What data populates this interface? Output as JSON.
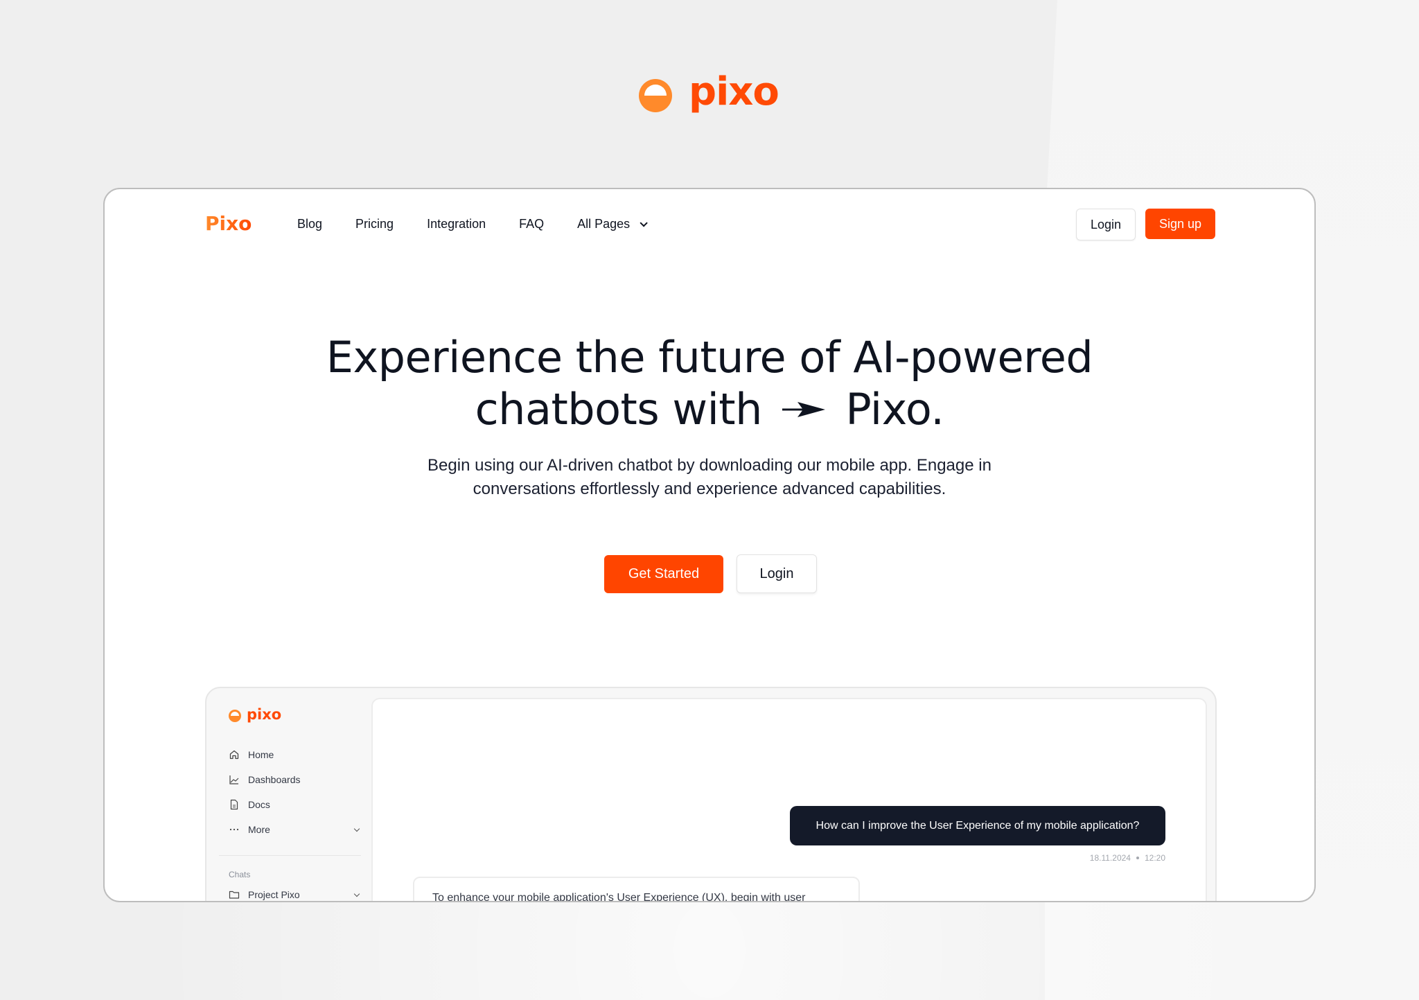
{
  "brand": {
    "name": "pixo",
    "accent": "#ff4500",
    "accent_light": "#ff8a2b"
  },
  "nav": {
    "logo": "Pixo",
    "links": [
      "Blog",
      "Pricing",
      "Integration",
      "FAQ",
      "All Pages"
    ],
    "login": "Login",
    "signup": "Sign up"
  },
  "hero": {
    "title_line1": "Experience the future of AI-powered",
    "title_line2_pre": "chatbots with",
    "title_line2_post": "Pixo.",
    "subtitle_line1": "Begin using our AI-driven chatbot by downloading our mobile app. Engage in",
    "subtitle_line2": "conversations effortlessly and experience advanced capabilities.",
    "cta_primary": "Get Started",
    "cta_secondary": "Login"
  },
  "app_preview": {
    "logo": "pixo",
    "sidebar": {
      "items": [
        {
          "label": "Home",
          "icon": "home-icon"
        },
        {
          "label": "Dashboards",
          "icon": "chart-icon"
        },
        {
          "label": "Docs",
          "icon": "document-icon"
        },
        {
          "label": "More",
          "icon": "more-icon"
        }
      ],
      "section_label": "Chats",
      "chats": [
        {
          "label": "Project Pixo",
          "icon": "folder-icon"
        }
      ]
    },
    "chat": {
      "user_message": "How can I improve the User Experience of my mobile application?",
      "date": "18.11.2024",
      "time": "12:20",
      "bot_message": "To enhance your mobile application's User Experience (UX), begin with user"
    }
  }
}
